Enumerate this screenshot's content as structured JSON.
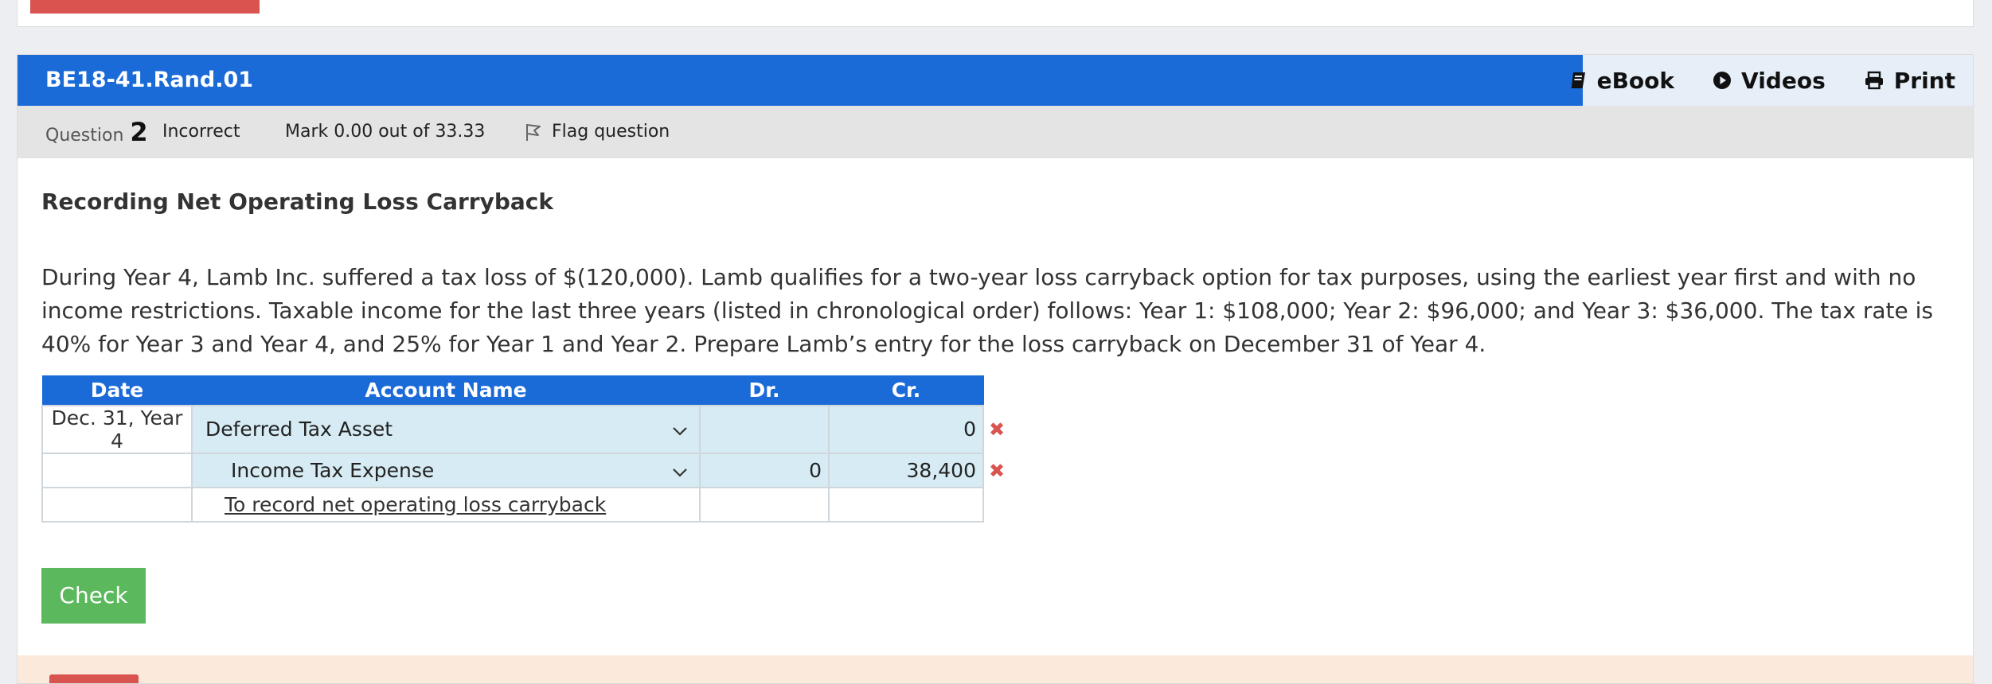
{
  "header": {
    "title": "BE18-41.Rand.01",
    "tools": [
      {
        "label": "eBook",
        "icon": "book-icon"
      },
      {
        "label": "Videos",
        "icon": "play-circle-icon"
      },
      {
        "label": "Print",
        "icon": "printer-icon"
      }
    ]
  },
  "info": {
    "question_label": "Question",
    "question_number": "2",
    "status": "Incorrect",
    "mark": "Mark 0.00 out of 33.33",
    "flag": "Flag question"
  },
  "question": {
    "title": "Recording Net Operating Loss Carryback",
    "text": "During Year 4, Lamb Inc. suffered a tax loss of $(120,000). Lamb qualifies for a two-year loss carryback option for tax purposes, using the earliest year first and with no income restrictions. Taxable income for the last three years (listed in chronological order) follows: Year 1: $108,000; Year 2: $96,000; and Year 3: $36,000. The tax rate is 40% for Year 3 and Year 4, and 25% for Year 1 and Year 2. Prepare Lamb’s entry for the loss carryback on December 31 of Year 4."
  },
  "journal": {
    "headers": {
      "date": "Date",
      "account": "Account Name",
      "dr": "Dr.",
      "cr": "Cr."
    },
    "rows": [
      {
        "date": "Dec. 31, Year 4",
        "account": "Deferred Tax Asset",
        "dr": "",
        "cr": "0"
      },
      {
        "date": "",
        "account": "Income Tax Expense",
        "dr": "0",
        "cr": "38,400"
      }
    ],
    "note": "To record net operating loss carryback"
  },
  "check_label": "Check",
  "colors": {
    "header_blue": "#1a6ad8",
    "input_blue": "#d6ebf3",
    "check_green": "#5cb85c",
    "error_red": "#d9534f"
  }
}
